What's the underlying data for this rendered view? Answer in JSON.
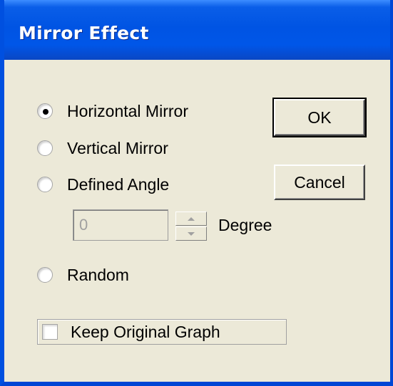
{
  "window": {
    "title": "Mirror Effect"
  },
  "options": {
    "horizontal": {
      "label": "Horizontal Mirror",
      "selected": true
    },
    "vertical": {
      "label": "Vertical Mirror",
      "selected": false
    },
    "defined_angle": {
      "label": "Defined Angle",
      "selected": false
    },
    "random": {
      "label": "Random",
      "selected": false
    }
  },
  "angle": {
    "value": "0",
    "unit_label": "Degree",
    "enabled": false
  },
  "keep_original": {
    "label": "Keep Original Graph",
    "checked": false
  },
  "buttons": {
    "ok_label": "OK",
    "cancel_label": "Cancel"
  },
  "colors": {
    "titlebar": "#0054e3",
    "face": "#ece9d8",
    "disabled_text": "#a0a0a0"
  }
}
